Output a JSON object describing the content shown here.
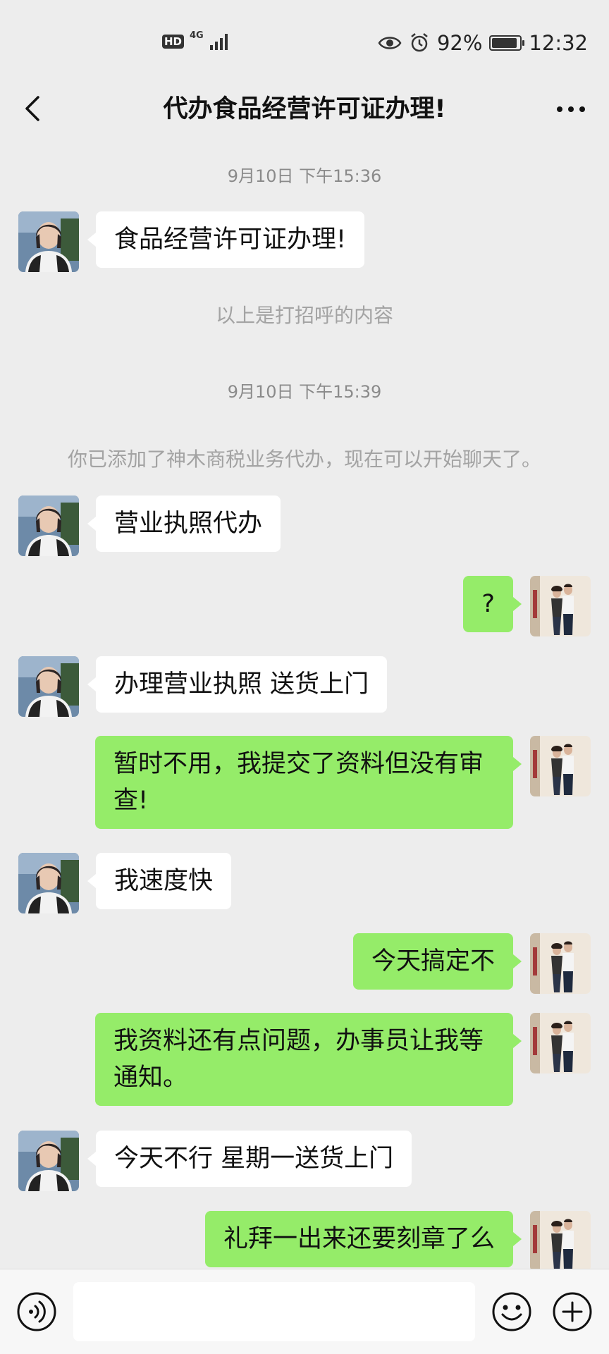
{
  "status_bar": {
    "hd_badge": "HD",
    "network_type": "4G",
    "battery_percent": "92%",
    "battery_level": 0.92,
    "time": "12:32",
    "icons": [
      "signal-icon",
      "eye-icon",
      "alarm-icon",
      "battery-icon"
    ]
  },
  "header": {
    "title": "代办食品经营许可证办理!",
    "back_icon": "chevron-left-icon",
    "more_icon": "more-dots-icon"
  },
  "chat": {
    "items": [
      {
        "kind": "time",
        "text": "9月10日 下午15:36"
      },
      {
        "kind": "msg",
        "side": "left",
        "text": "食品经营许可证办理!"
      },
      {
        "kind": "note",
        "text": "以上是打招呼的内容"
      },
      {
        "kind": "time",
        "text": "9月10日 下午15:39"
      },
      {
        "kind": "note",
        "text": "你已添加了神木商税业务代办，现在可以开始聊天了。"
      },
      {
        "kind": "msg",
        "side": "left",
        "text": "营业执照代办"
      },
      {
        "kind": "msg",
        "side": "right",
        "text": "?"
      },
      {
        "kind": "msg",
        "side": "left",
        "text": "办理营业执照  送货上门"
      },
      {
        "kind": "msg",
        "side": "right",
        "text": "暂时不用，我提交了资料但没有审查!"
      },
      {
        "kind": "msg",
        "side": "left",
        "text": "我速度快"
      },
      {
        "kind": "msg",
        "side": "right",
        "text": "今天搞定不"
      },
      {
        "kind": "msg",
        "side": "right",
        "text": "我资料还有点问题，办事员让我等通知。"
      },
      {
        "kind": "msg",
        "side": "left",
        "text": "今天不行  星期一送货上门"
      },
      {
        "kind": "msg",
        "side": "right",
        "text": "礼拜一出来还要刻章了么"
      }
    ]
  },
  "input_bar": {
    "text_value": "",
    "voice_icon": "voice-icon",
    "emoji_icon": "emoji-icon",
    "plus_icon": "plus-icon"
  },
  "colors": {
    "background": "#ededed",
    "bubble_self": "#95ec69",
    "bubble_other": "#ffffff",
    "meta_text": "#8a8a8a"
  }
}
